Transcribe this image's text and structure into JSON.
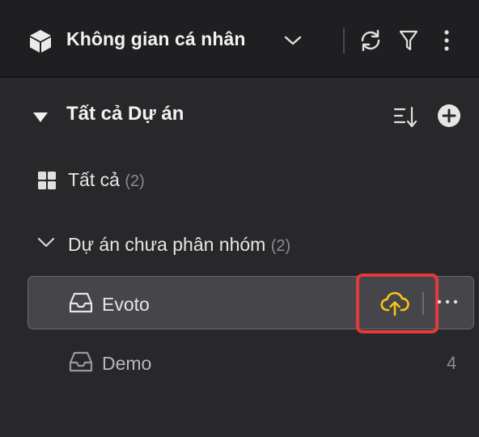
{
  "workspace": {
    "title": "Không gian cá nhân"
  },
  "projects_section": {
    "title": "Tất cả Dự án"
  },
  "all_item": {
    "label": "Tất cả",
    "count": "(2)"
  },
  "group": {
    "label": "Dự án chưa phân nhóm",
    "count": "(2)"
  },
  "projects": [
    {
      "name": "Evoto",
      "selected": true
    },
    {
      "name": "Demo",
      "count": "4"
    }
  ],
  "icons": {
    "workspace": "cube-icon",
    "dropdown": "chevron-down-icon",
    "refresh": "refresh-icon",
    "filter": "filter-icon",
    "more": "more-vertical-icon",
    "collapse": "triangle-down-icon",
    "sort": "sort-icon",
    "add": "plus-circle-icon",
    "all": "grid-icon",
    "project": "inbox-icon",
    "upload": "cloud-upload-icon",
    "row_more": "more-horizontal-icon"
  },
  "colors": {
    "background": "#28282b",
    "topbar": "#1f1f21",
    "selected_row": "#46464a",
    "highlight": "#e5393a",
    "upload_icon": "#f5c518"
  }
}
